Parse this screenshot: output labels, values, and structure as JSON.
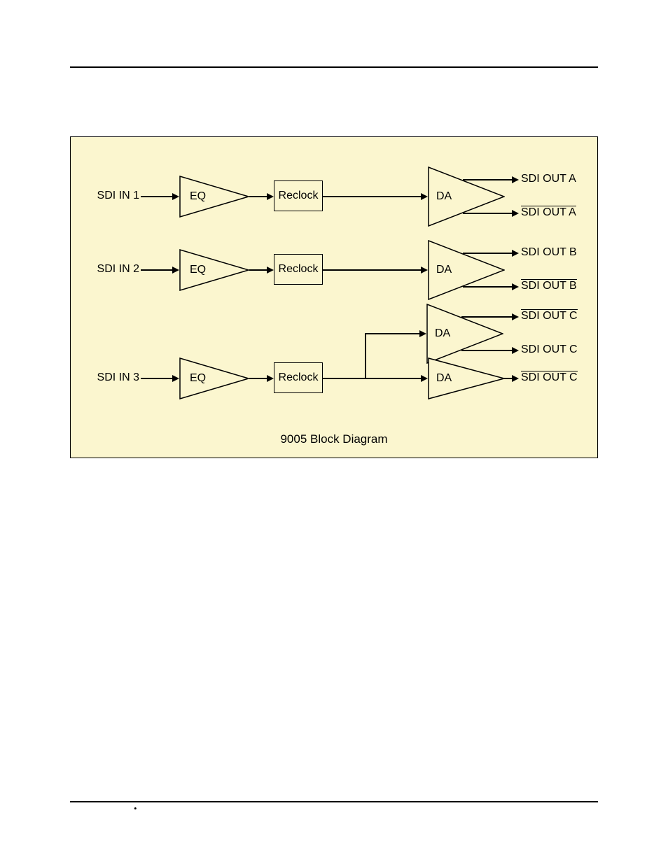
{
  "caption": "9005 Block Diagram",
  "inputs": [
    "SDI IN 1",
    "SDI IN 2",
    "SDI IN 3"
  ],
  "outputs": {
    "a1": "SDI OUT A",
    "a2": "SDI OUT A",
    "b1": "SDI OUT B",
    "b2": "SDI OUT B",
    "c1": "SDI OUT C",
    "c2": "SDI OUT C",
    "c3": "SDI OUT C"
  },
  "blocks": {
    "eq": "EQ",
    "reclock": "Reclock",
    "da": "DA"
  },
  "chart_data": {
    "type": "block-diagram",
    "title": "9005 Block Diagram",
    "channels": [
      {
        "input": "SDI IN 1",
        "stages": [
          "EQ",
          "Reclock",
          "DA"
        ],
        "outputs": [
          {
            "label": "SDI OUT A",
            "polarity": "normal"
          },
          {
            "label": "SDI OUT A",
            "polarity": "inverted"
          }
        ]
      },
      {
        "input": "SDI IN 2",
        "stages": [
          "EQ",
          "Reclock",
          "DA"
        ],
        "outputs": [
          {
            "label": "SDI OUT B",
            "polarity": "normal"
          },
          {
            "label": "SDI OUT B",
            "polarity": "inverted"
          }
        ]
      },
      {
        "input": "SDI IN 3",
        "stages": [
          "EQ",
          "Reclock"
        ],
        "da_stages": [
          "DA",
          "DA"
        ],
        "outputs": [
          {
            "label": "SDI OUT C",
            "polarity": "inverted"
          },
          {
            "label": "SDI OUT C",
            "polarity": "normal"
          },
          {
            "label": "SDI OUT C",
            "polarity": "inverted"
          }
        ]
      }
    ]
  }
}
